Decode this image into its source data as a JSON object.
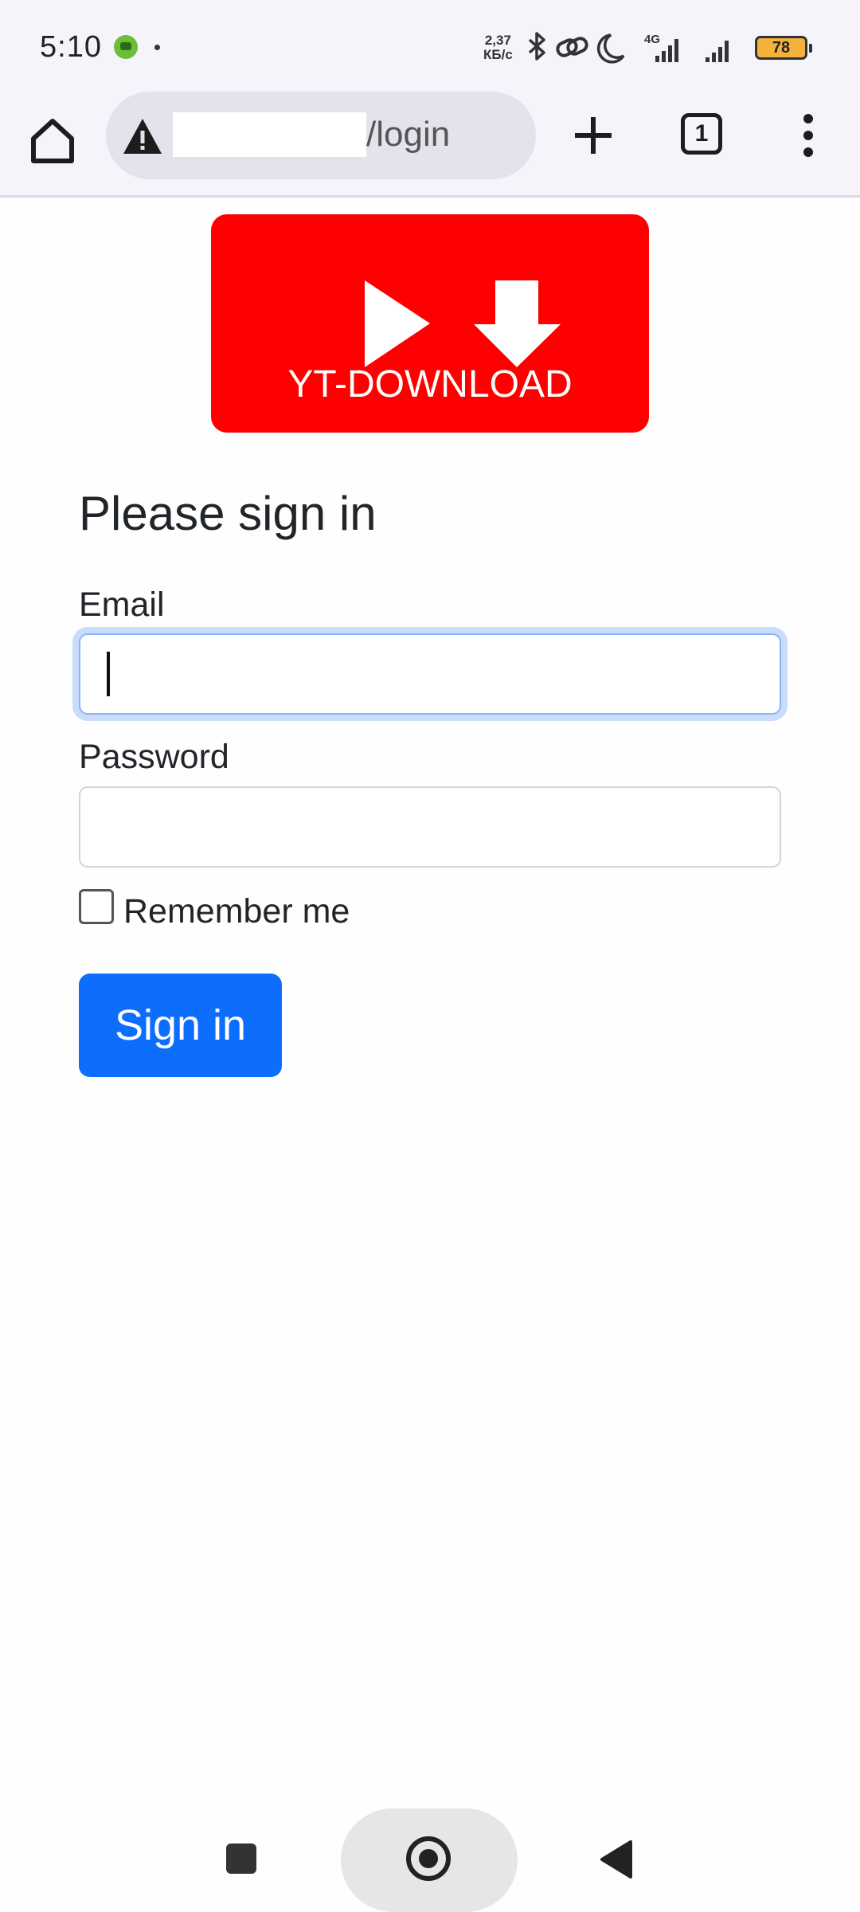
{
  "status_bar": {
    "time": "5:10",
    "net_speed_value": "2,37",
    "net_speed_unit": "КБ/с",
    "network_type": "4G",
    "battery": "78",
    "icons": [
      "app-notification-icon",
      "bluetooth-icon",
      "link-icon",
      "moon-icon",
      "signal-icon",
      "signal-icon",
      "battery-icon"
    ]
  },
  "browser": {
    "url_path": "/login",
    "tab_count": "1",
    "icons": [
      "home-icon",
      "warning-icon",
      "plus-icon",
      "tabs-icon",
      "more-vert-icon"
    ]
  },
  "page": {
    "logo_text": "YT-DOWNLOAD",
    "heading": "Please sign in",
    "email_label": "Email",
    "email_value": "",
    "password_label": "Password",
    "password_value": "",
    "remember_label": "Remember me",
    "remember_checked": false,
    "signin_label": "Sign in",
    "colors": {
      "logo_bg": "#ff0000",
      "button_bg": "#0d6efd",
      "focus_ring": "#c9dcfb"
    }
  },
  "nav": {
    "icons": [
      "recents-icon",
      "home-icon",
      "back-icon"
    ]
  }
}
